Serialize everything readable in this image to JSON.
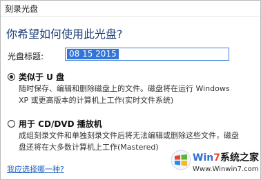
{
  "window": {
    "title": "刻录光盘"
  },
  "main": {
    "heading": "你希望如何使用此光盘?",
    "disc_title_label": "光盘标题:",
    "disc_title_value": "08 15 2015"
  },
  "options": [
    {
      "label": "类似于 U 盘",
      "selected": true,
      "desc_lines": [
        "随时保存、编辑和删除磁盘上的文件。磁盘将在运行 Windows",
        "XP 或更高版本的计算机上工作(实时文件系统)"
      ]
    },
    {
      "label": "用于 CD/DVD 播放机",
      "selected": false,
      "desc_lines": [
        "成组刻录文件和单独刻录文件后将无法编辑或删除这些文件，磁盘",
        "盘还将在大多数计算机上工作(Mastered)"
      ]
    }
  ],
  "help_link": "我应选择哪一种?",
  "watermark": {
    "brand_prefix": "Win",
    "brand_number": "7",
    "brand_suffix": "系统之家",
    "url": "Www.Winwin7.com"
  },
  "colors": {
    "heading": "#1e3f7a",
    "selection": "#3375d7",
    "link": "#1f5fbf"
  }
}
